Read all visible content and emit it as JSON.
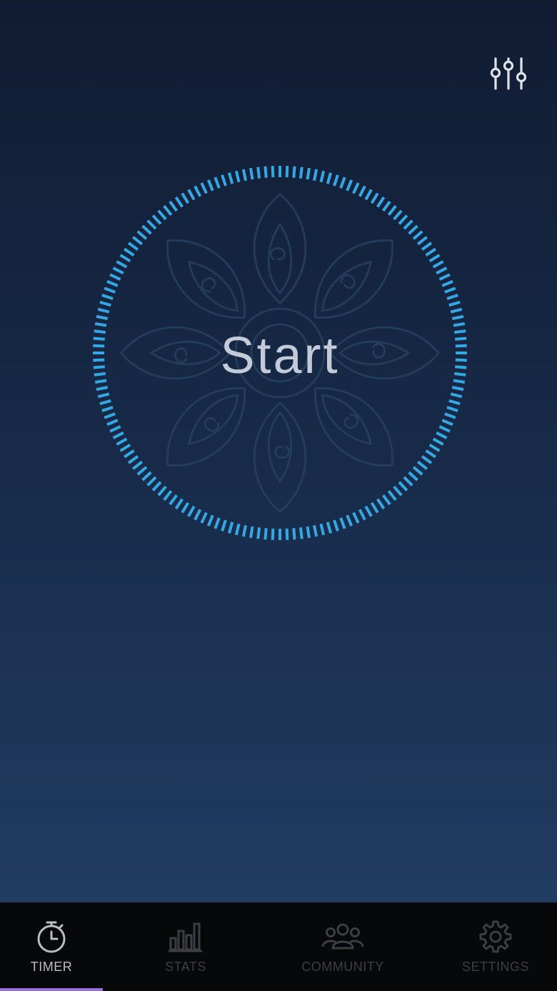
{
  "main": {
    "start_label": "Start",
    "filters_icon": "sliders-icon",
    "ring_color": "#35a7e3",
    "background_top": "#111c33",
    "background_bottom": "#223f64"
  },
  "tabs": [
    {
      "label": "TIMER",
      "icon": "stopwatch-icon",
      "active": true
    },
    {
      "label": "STATS",
      "icon": "bar-chart-icon",
      "active": false
    },
    {
      "label": "COMMUNITY",
      "icon": "people-icon",
      "active": false
    },
    {
      "label": "SETTINGS",
      "icon": "gear-icon",
      "active": false
    }
  ],
  "colors": {
    "tab_active": "#b9bdc6",
    "tab_inactive": "#3b3e45",
    "active_indicator": "#9a6fd6",
    "tabbar_bg": "#070809"
  }
}
